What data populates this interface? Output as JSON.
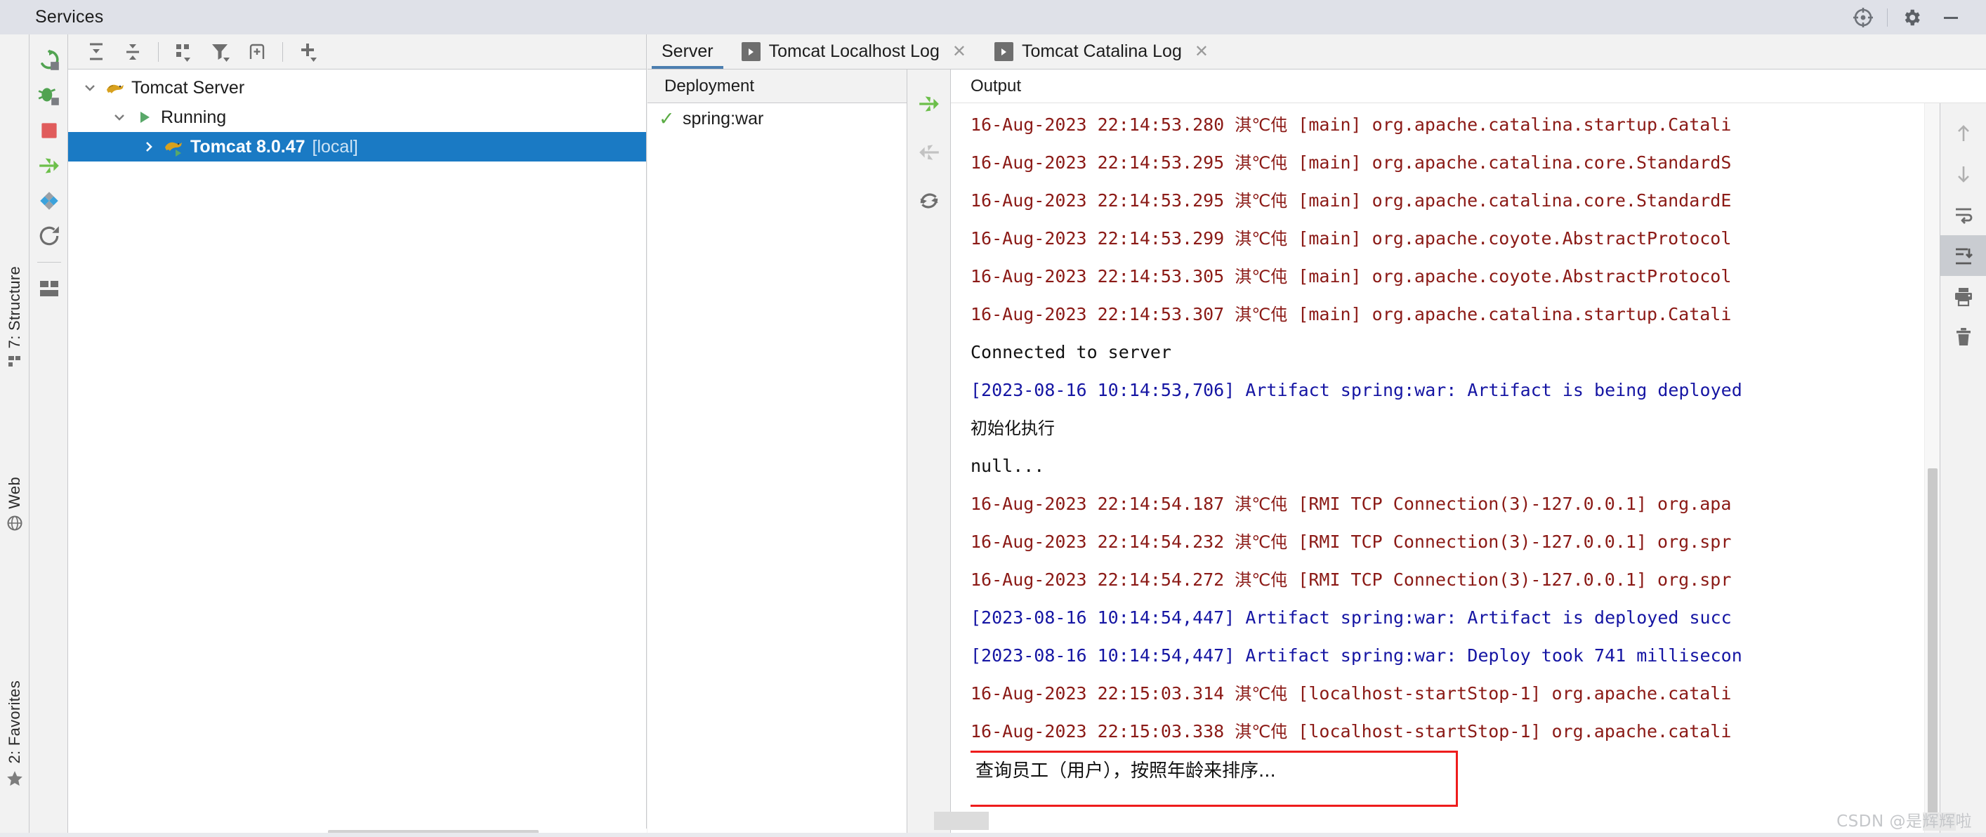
{
  "window": {
    "title": "Services",
    "controls": [
      {
        "name": "locate-icon",
        "glyph": "target"
      },
      {
        "name": "settings-icon",
        "glyph": "gear"
      },
      {
        "name": "minimize-icon",
        "glyph": "minus"
      }
    ]
  },
  "left_vertical_tabs": [
    {
      "label": "7: Structure",
      "icon": "structure-icon"
    },
    {
      "label": "Web",
      "icon": "web-globe-icon"
    },
    {
      "label": "2: Favorites",
      "icon": "star-icon"
    }
  ],
  "left_tool_column": [
    {
      "name": "rerun-button",
      "icon": "rerun-icon",
      "color": "#51a351"
    },
    {
      "name": "debug-button",
      "icon": "debug-bug-icon",
      "color": "#51a351"
    },
    {
      "name": "stop-button",
      "icon": "stop-square-icon",
      "color": "#e05c5c"
    },
    {
      "name": "deploy-button",
      "icon": "deploy-arrows-icon",
      "color": "#6cbf4a"
    },
    {
      "name": "edit-configuration-button",
      "icon": "diamond-icon",
      "color": "#3ba2dc"
    },
    {
      "name": "restart-button",
      "icon": "refresh-circle-icon",
      "color": "#6e6e6e"
    },
    {
      "name": "layout-button",
      "icon": "layout-blocks-icon",
      "color": "#6e6e6e"
    }
  ],
  "services_toolbar": [
    {
      "name": "expand-all-button",
      "icon": "expand-all-icon"
    },
    {
      "name": "collapse-all-button",
      "icon": "collapse-all-icon"
    },
    {
      "name": "group-by-button",
      "icon": "group-by-icon"
    },
    {
      "name": "filter-button",
      "icon": "filter-icon"
    },
    {
      "name": "show-in-new-window-button",
      "icon": "new-window-icon"
    },
    {
      "name": "add-service-button",
      "icon": "plus-icon"
    }
  ],
  "tree": {
    "nodes": [
      {
        "label": "Tomcat Server",
        "icon": "tomcat-icon",
        "expanded": true,
        "indent": 0,
        "selected": false
      },
      {
        "label": "Running",
        "icon": "run-green-icon",
        "expanded": true,
        "indent": 1,
        "selected": false
      },
      {
        "label": "Tomcat 8.0.47",
        "sublabel": "[local]",
        "icon": "tomcat-running-icon",
        "expanded": false,
        "indent": 2,
        "selected": true
      }
    ]
  },
  "tabs": [
    {
      "label": "Server",
      "active": true,
      "closable": false,
      "icon": null
    },
    {
      "label": "Tomcat Localhost Log",
      "active": false,
      "closable": true,
      "icon": "run-tab-icon"
    },
    {
      "label": "Tomcat Catalina Log",
      "active": false,
      "closable": true,
      "icon": "run-tab-icon"
    }
  ],
  "deployment": {
    "header": "Deployment",
    "items": [
      {
        "label": "spring:war",
        "status_icon": "check-green-icon"
      }
    ],
    "buttons": [
      {
        "name": "deploy-artifact-button",
        "icon": "deploy-arrows-icon",
        "enabled": true
      },
      {
        "name": "undeploy-artifact-button",
        "icon": "undeploy-arrows-icon",
        "enabled": false
      },
      {
        "name": "redeploy-artifact-button",
        "icon": "redeploy-icon",
        "enabled": true
      }
    ]
  },
  "output": {
    "header": "Output",
    "lines": [
      {
        "color": "red",
        "text": "16-Aug-2023 22:14:53.280 ",
        "cjk": "淇℃伅",
        "tail": " [main] org.apache.catalina.startup.Catali",
        "clipped": true
      },
      {
        "color": "red",
        "text": "16-Aug-2023 22:14:53.295 ",
        "cjk": "淇℃伅",
        "tail": " [main] org.apache.catalina.core.StandardS",
        "clipped": true
      },
      {
        "color": "red",
        "text": "16-Aug-2023 22:14:53.295 ",
        "cjk": "淇℃伅",
        "tail": " [main] org.apache.catalina.core.StandardE",
        "clipped": true
      },
      {
        "color": "red",
        "text": "16-Aug-2023 22:14:53.299 ",
        "cjk": "淇℃伅",
        "tail": " [main] org.apache.coyote.AbstractProtocol",
        "clipped": true
      },
      {
        "color": "red",
        "text": "16-Aug-2023 22:14:53.305 ",
        "cjk": "淇℃伅",
        "tail": " [main] org.apache.coyote.AbstractProtocol",
        "clipped": true
      },
      {
        "color": "red",
        "text": "16-Aug-2023 22:14:53.307 ",
        "cjk": "淇℃伅",
        "tail": " [main] org.apache.catalina.startup.Catali",
        "clipped": true
      },
      {
        "color": "black",
        "text": "Connected to server",
        "cjk": "",
        "tail": "",
        "clipped": false
      },
      {
        "color": "blue",
        "text": "[2023-08-16 10:14:53,706] Artifact spring:war: Artifact is being deployed",
        "cjk": "",
        "tail": "",
        "clipped": true
      },
      {
        "color": "black",
        "text": "",
        "cjk": "初始化执行",
        "tail": "",
        "clipped": false
      },
      {
        "color": "black",
        "text": "null...",
        "cjk": "",
        "tail": "",
        "clipped": false
      },
      {
        "color": "red",
        "text": "16-Aug-2023 22:14:54.187 ",
        "cjk": "淇℃伅",
        "tail": " [RMI TCP Connection(3)-127.0.0.1] org.apa",
        "clipped": true
      },
      {
        "color": "red",
        "text": "16-Aug-2023 22:14:54.232 ",
        "cjk": "淇℃伅",
        "tail": " [RMI TCP Connection(3)-127.0.0.1] org.spr",
        "clipped": true
      },
      {
        "color": "red",
        "text": "16-Aug-2023 22:14:54.272 ",
        "cjk": "淇℃伅",
        "tail": " [RMI TCP Connection(3)-127.0.0.1] org.spr",
        "clipped": true
      },
      {
        "color": "blue",
        "text": "[2023-08-16 10:14:54,447] Artifact spring:war: Artifact is deployed succ",
        "cjk": "",
        "tail": "",
        "clipped": true
      },
      {
        "color": "blue",
        "text": "[2023-08-16 10:14:54,447] Artifact spring:war: Deploy took 741 millisecon",
        "cjk": "",
        "tail": "",
        "clipped": true
      },
      {
        "color": "red",
        "text": "16-Aug-2023 22:15:03.314 ",
        "cjk": "淇℃伅",
        "tail": " [localhost-startStop-1] org.apache.catali",
        "clipped": true
      },
      {
        "color": "red",
        "text": "16-Aug-2023 22:15:03.338 ",
        "cjk": "淇℃伅",
        "tail": " [localhost-startStop-1] org.apache.catali",
        "clipped": true
      }
    ],
    "highlight": {
      "text": "查询员工（用户），按照年龄来排序...",
      "border_color": "#ee1c1c"
    },
    "tools": [
      {
        "name": "scroll-up-button",
        "icon": "arrow-up-icon",
        "active": false
      },
      {
        "name": "scroll-down-button",
        "icon": "arrow-down-icon",
        "active": false
      },
      {
        "name": "soft-wrap-button",
        "icon": "soft-wrap-icon",
        "active": false
      },
      {
        "name": "scroll-to-end-button",
        "icon": "scroll-to-end-icon",
        "active": true
      },
      {
        "name": "print-button",
        "icon": "printer-icon",
        "active": false
      },
      {
        "name": "clear-all-button",
        "icon": "trash-icon",
        "active": false
      }
    ]
  },
  "watermark": {
    "prefix": "CSDN @是",
    "highlight": "辉辉",
    "suffix": "啦"
  },
  "colors": {
    "selection_blue": "#1a7ac4",
    "log_red": "#8b1a16",
    "log_blue": "#1515a3",
    "green_accent": "#6cbf4a",
    "titlebar": "#dfe1e8"
  }
}
